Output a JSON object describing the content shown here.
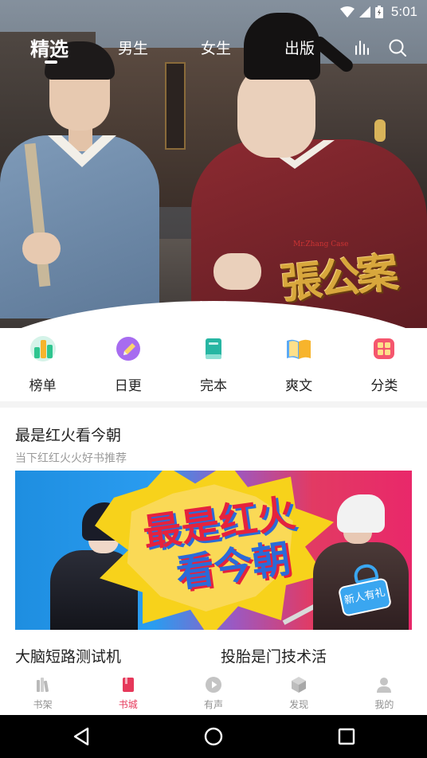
{
  "status_bar": {
    "time": "5:01"
  },
  "top_tabs": [
    {
      "label": "精选",
      "active": true
    },
    {
      "label": "男生",
      "active": false
    },
    {
      "label": "女生",
      "active": false
    },
    {
      "label": "出版",
      "active": false
    }
  ],
  "top_icons": [
    "chart-bars-icon",
    "search-icon"
  ],
  "hero_banner": {
    "poster_title": "張公案",
    "poster_subtitle": "Mr.Zhang Case",
    "dots": 4,
    "active_dot": 0
  },
  "quick_nav": [
    {
      "label": "榜单",
      "icon": "ranking-icon",
      "color": "#2fc58f"
    },
    {
      "label": "日更",
      "icon": "pencil-icon",
      "color": "#a76cf0"
    },
    {
      "label": "完本",
      "icon": "book-icon",
      "color": "#27b6a3"
    },
    {
      "label": "爽文",
      "icon": "open-book-icon",
      "color": "#f7b42c"
    },
    {
      "label": "分类",
      "icon": "category-grid-icon",
      "color": "#f5566e"
    }
  ],
  "section": {
    "title": "最是红火看今朝",
    "subtitle": "当下红红火火好书推荐",
    "banner": {
      "line1": "最是红火",
      "line2": "看今朝",
      "badge": "新人有礼"
    },
    "books": [
      "大脑短路测试机",
      "投胎是门技术活"
    ]
  },
  "bottom_nav": [
    {
      "label": "书架",
      "icon": "bookshelf-icon",
      "active": false
    },
    {
      "label": "书城",
      "icon": "bookstore-icon",
      "active": true
    },
    {
      "label": "有声",
      "icon": "play-circle-icon",
      "active": false
    },
    {
      "label": "发现",
      "icon": "cube-icon",
      "active": false
    },
    {
      "label": "我的",
      "icon": "profile-icon",
      "active": false
    }
  ],
  "colors": {
    "accent": "#e6385a",
    "inactive_nav": "#8f8f8f",
    "subtitle": "#9a9a9a"
  }
}
